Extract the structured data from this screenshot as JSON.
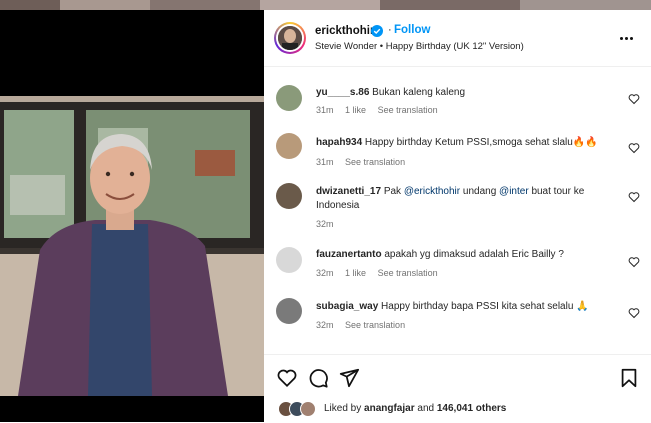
{
  "header": {
    "username": "erickthohir",
    "follow_label": "Follow",
    "audio": "Stevie Wonder • Happy Birthday (UK 12\" Version)",
    "more_icon": "more-horizontal-icon"
  },
  "comments": [
    {
      "user": "yu____s.86",
      "text": "Bukan kaleng kaleng",
      "time": "31m",
      "likes": "1 like",
      "translate": "See translation",
      "avatar_color": "#8a9a7a"
    },
    {
      "user": "hapah934",
      "text": "Happy birthday Ketum PSSI,smoga sehat slalu🔥🔥",
      "time": "31m",
      "likes": "",
      "translate": "See translation",
      "avatar_color": "#b89a7a"
    },
    {
      "user": "dwizanetti_17",
      "text_before": "Pak",
      "mention1": "@erickthohir",
      "text_mid": "undang",
      "mention2": "@inter",
      "text_after": "buat tour ke Indonesia",
      "time": "32m",
      "avatar_color": "#6a5a4a"
    },
    {
      "user": "fauzanertanto",
      "text": "apakah yg dimaksud adalah Eric Bailly ?",
      "time": "32m",
      "likes": "1 like",
      "translate": "See translation",
      "avatar_color": "#d8d8d8"
    },
    {
      "user": "subagia_way",
      "text": "Happy birthday bapa PSSI kita sehat selalu 🙏",
      "time": "32m",
      "likes": "",
      "translate": "See translation",
      "avatar_color": "#7a7a7a"
    }
  ],
  "likes": {
    "prefix": "Liked by",
    "user": "anangfajar",
    "and": "and",
    "count": "146,041 others"
  },
  "colors": {
    "accent": "#0095f6",
    "text": "#262626",
    "muted": "#737373"
  }
}
